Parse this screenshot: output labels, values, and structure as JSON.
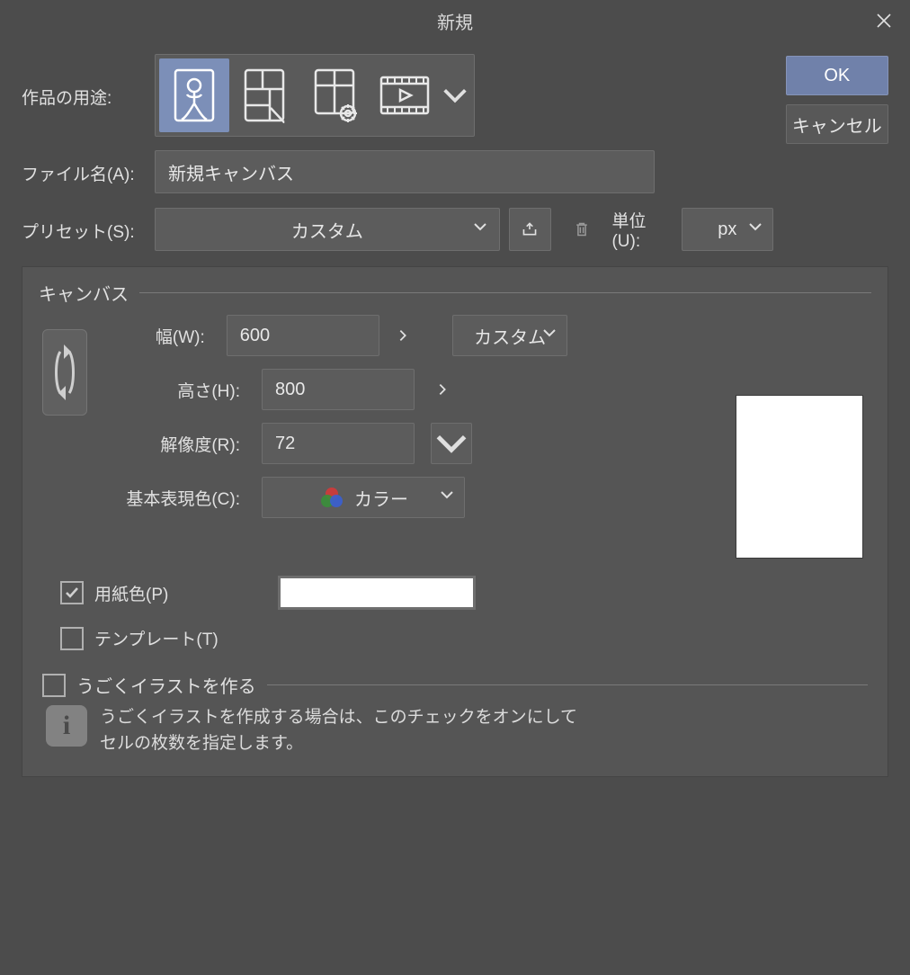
{
  "title": "新規",
  "buttons": {
    "ok": "OK",
    "cancel": "キャンセル"
  },
  "labels": {
    "purpose": "作品の用途:",
    "filename": "ファイル名(A):",
    "preset": "プリセット(S):",
    "unit": "単位(U):"
  },
  "filename_value": "新規キャンバス",
  "preset_value": "カスタム",
  "unit_value": "px",
  "canvas": {
    "group_title": "キャンバス",
    "width_label": "幅(W):",
    "width_value": "600",
    "height_label": "高さ(H):",
    "height_value": "800",
    "resolution_label": "解像度(R):",
    "resolution_value": "72",
    "colormode_label": "基本表現色(C):",
    "colormode_value": "カラー",
    "size_preset": "カスタム",
    "paper_label": "用紙色(P)",
    "template_label": "テンプレート(T)"
  },
  "anim": {
    "head": "うごくイラストを作る",
    "info": "うごくイラストを作成する場合は、このチェックをオンにして\nセルの枚数を指定します。"
  }
}
